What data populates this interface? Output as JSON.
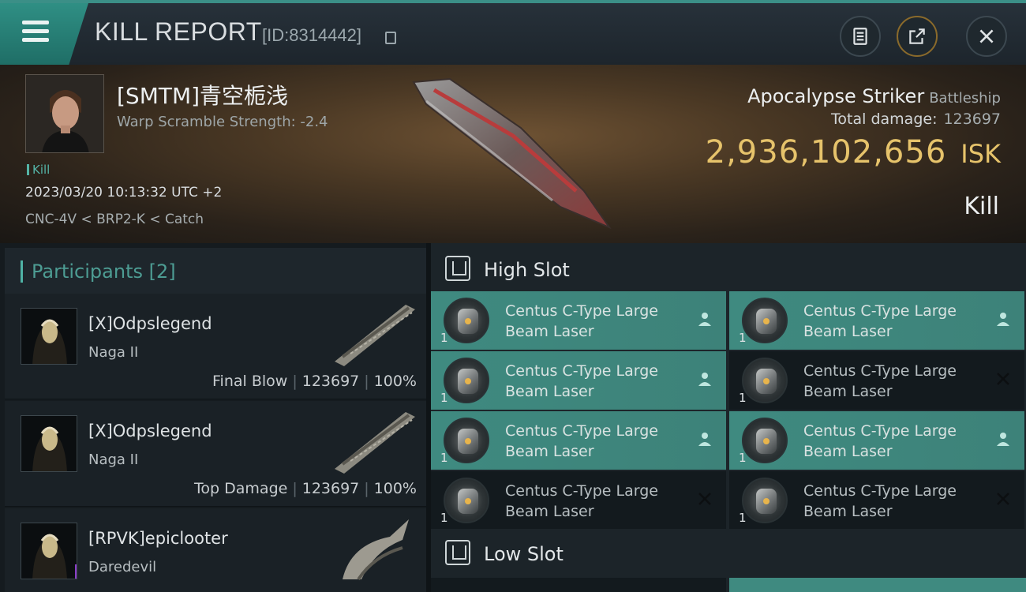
{
  "header": {
    "title": "KILL REPORT",
    "id_text": "[ID:8314442]"
  },
  "victim": {
    "name": "[SMTM]青空栀浅",
    "warp_scramble": "Warp Scramble Strength: -2.4",
    "tag": "Kill",
    "datetime": "2023/03/20 10:13:32 UTC +2",
    "location": "CNC-4V < BRP2-K < Catch",
    "ship": "Apocalypse Striker",
    "ship_class": "Battleship",
    "total_damage_label": "Total damage:",
    "total_damage": "123697",
    "isk_value": "2,936,102,656",
    "isk_unit": "ISK",
    "result": "Kill"
  },
  "participants": {
    "header": "Participants [2]",
    "items": [
      {
        "name": "[X]Odpslegend",
        "ship": "Naga II",
        "role": "Final Blow",
        "damage": "123697",
        "percent": "100%"
      },
      {
        "name": "[X]Odpslegend",
        "ship": "Naga II",
        "role": "Top Damage",
        "damage": "123697",
        "percent": "100%"
      },
      {
        "name": "[RPVK]epiclooter",
        "ship": "Daredevil",
        "badge": "i"
      }
    ]
  },
  "fitting": {
    "high_slot_label": "High Slot",
    "low_slot_label": "Low Slot",
    "high_slot": [
      {
        "name_line1": "Centus C-Type Large",
        "name_line2": "Beam Laser",
        "qty": "1",
        "state": "dropped"
      },
      {
        "name_line1": "Centus C-Type Large",
        "name_line2": "Beam Laser",
        "qty": "1",
        "state": "dropped"
      },
      {
        "name_line1": "Centus C-Type Large",
        "name_line2": "Beam Laser",
        "qty": "1",
        "state": "dropped"
      },
      {
        "name_line1": "Centus C-Type Large",
        "name_line2": "Beam Laser",
        "qty": "1",
        "state": "destroyed"
      },
      {
        "name_line1": "Centus C-Type Large",
        "name_line2": "Beam Laser",
        "qty": "1",
        "state": "dropped"
      },
      {
        "name_line1": "Centus C-Type Large",
        "name_line2": "Beam Laser",
        "qty": "1",
        "state": "dropped"
      },
      {
        "name_line1": "Centus C-Type Large",
        "name_line2": "Beam Laser",
        "qty": "1",
        "state": "destroyed"
      },
      {
        "name_line1": "Centus C-Type Large",
        "name_line2": "Beam Laser",
        "qty": "1",
        "state": "destroyed"
      }
    ]
  },
  "colors": {
    "accent": "#3f8a80",
    "isk_gold": "#e6c36b",
    "participant_header": "#4d9c93",
    "badge_purple": "#8a3cc8"
  },
  "icons": {
    "menu": "hamburger-icon",
    "copy": "copy-icon",
    "clipboard": "clipboard-icon",
    "share": "share-icon",
    "close": "close-icon",
    "dropped": "person-icon",
    "destroyed": "x-icon"
  }
}
